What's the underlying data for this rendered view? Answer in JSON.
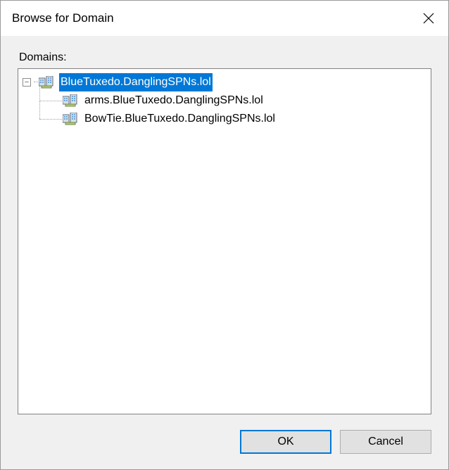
{
  "title": "Browse for Domain",
  "label": "Domains:",
  "tree": {
    "root": {
      "label": "BlueTuxedo.DanglingSPNs.lol",
      "expanded": true,
      "selected": true,
      "children": [
        {
          "label": "arms.BlueTuxedo.DanglingSPNs.lol"
        },
        {
          "label": "BowTie.BlueTuxedo.DanglingSPNs.lol"
        }
      ]
    }
  },
  "buttons": {
    "ok": "OK",
    "cancel": "Cancel"
  },
  "expander_glyph_minus": "−"
}
